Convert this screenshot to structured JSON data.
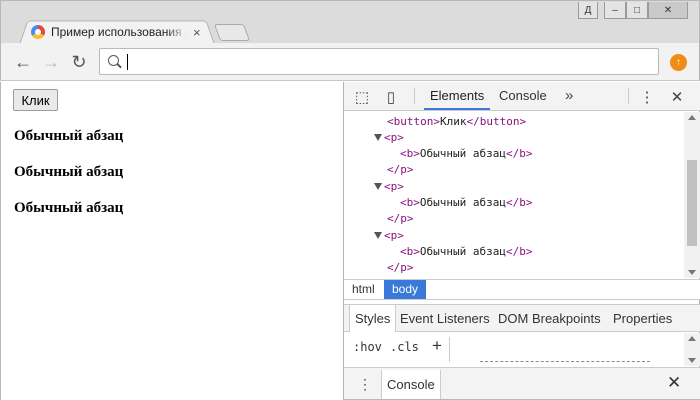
{
  "browser": {
    "tab_title": "Пример использования jQuery",
    "tab_close": "×",
    "window_user_badge": "Д",
    "window_min": "–",
    "window_max": "□",
    "window_close": "✕"
  },
  "toolbar": {
    "back_glyph": "←",
    "forward_glyph": "→",
    "reload_glyph": "↻",
    "address_value": "",
    "extension_glyph": "↑"
  },
  "page": {
    "button_label": "Клик",
    "paragraphs": [
      "Обычный абзац",
      "Обычный абзац",
      "Обычный абзац"
    ]
  },
  "devtools": {
    "inspect_glyph": "⬚",
    "device_glyph": "▯",
    "tabs": [
      "Elements",
      "Console"
    ],
    "more_glyph": "»",
    "menu_glyph": "⋮",
    "close_glyph": "✕",
    "dom": {
      "button_open": "<button>",
      "button_text": "Клик",
      "button_close": "</button>",
      "p_open": "<p>",
      "b_open": "<b>",
      "b_text": "Обычный абзац",
      "b_close": "</b>",
      "p_close": "</p>"
    },
    "breadcrumbs": [
      "html",
      "body"
    ],
    "style_tabs": [
      "Styles",
      "Event Listeners",
      "DOM Breakpoints",
      "Properties"
    ],
    "hov": ":hov",
    "cls": ".cls",
    "plus": "+",
    "drawer_tab": "Console",
    "drawer_close": "✕",
    "drawer_menu": "⋮"
  },
  "colors": {
    "accent": "#3879d9",
    "tag": "#881280",
    "extension": "#f08c14"
  }
}
